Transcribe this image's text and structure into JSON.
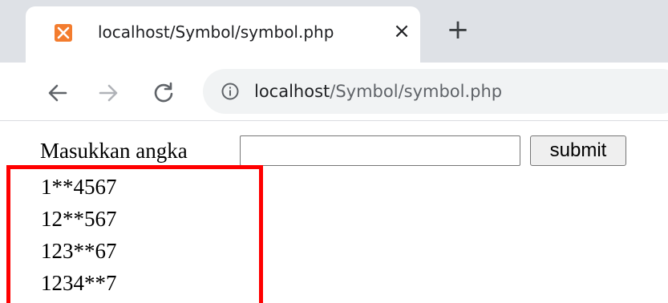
{
  "browser": {
    "tab": {
      "title": "localhost/Symbol/symbol.php",
      "favicon": "xampp-icon",
      "close_glyph": "×"
    },
    "new_tab_glyph": "+",
    "address_bar": {
      "host": "localhost",
      "path": "/Symbol/symbol.php"
    },
    "icons": {
      "back": "back-arrow-icon",
      "forward": "forward-arrow-icon",
      "reload": "reload-icon",
      "info": "info-icon"
    }
  },
  "page": {
    "form": {
      "label": "Masukkan angka",
      "input_value": "",
      "submit_label": "submit"
    },
    "results": [
      "1**4567",
      "12**567",
      "123**67",
      "1234**7"
    ]
  },
  "colors": {
    "annotation": "#ff0000",
    "favicon": "#f37c2e",
    "tabstrip": "#dee1e6"
  }
}
